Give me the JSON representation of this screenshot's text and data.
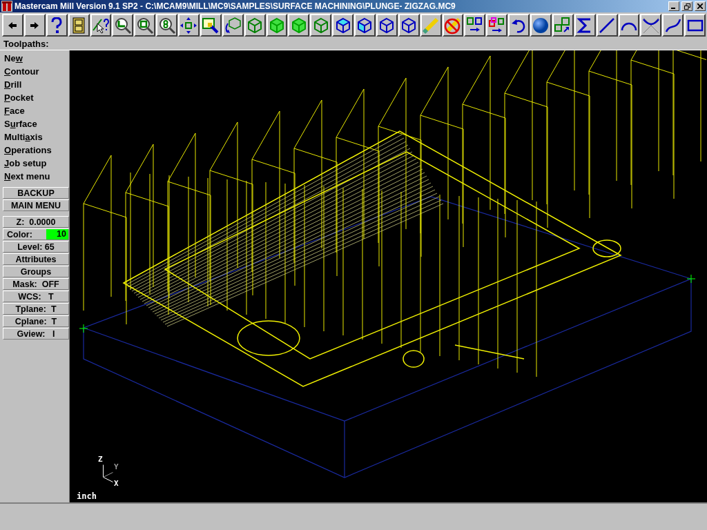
{
  "window": {
    "title": "Mastercam Mill Version 9.1 SP2 - C:\\MCAM9\\MILL\\MC9\\SAMPLES\\SURFACE MACHINING\\PLUNGE- ZIGZAG.MC9"
  },
  "toolbar": [
    {
      "kind": "arrow-left"
    },
    {
      "kind": "arrow-right"
    },
    {
      "kind": "help"
    },
    {
      "kind": "cabinet"
    },
    {
      "kind": "pointer-help"
    },
    {
      "kind": "zoom-window"
    },
    {
      "kind": "zoom-box"
    },
    {
      "kind": "zoom-eight"
    },
    {
      "kind": "pan"
    },
    {
      "kind": "paint"
    },
    {
      "kind": "rotate"
    },
    {
      "kind": "cube-green"
    },
    {
      "kind": "cube-green-light"
    },
    {
      "kind": "cube-green-light"
    },
    {
      "kind": "cube-green"
    },
    {
      "kind": "cube-blue-top"
    },
    {
      "kind": "cube-blue-front"
    },
    {
      "kind": "cube-blue"
    },
    {
      "kind": "cube-blue"
    },
    {
      "kind": "pencil"
    },
    {
      "kind": "pencil-no"
    },
    {
      "kind": "squares-arrow"
    },
    {
      "kind": "squares-arrow-color"
    },
    {
      "kind": "undo"
    },
    {
      "kind": "sphere"
    },
    {
      "kind": "cubes-arrow"
    },
    {
      "kind": "sigma"
    },
    {
      "kind": "line"
    },
    {
      "kind": "arc"
    },
    {
      "kind": "fillet"
    },
    {
      "kind": "spline"
    },
    {
      "kind": "rectangle"
    }
  ],
  "prompt": "Toolpaths:",
  "menu": [
    {
      "lead": "Ne",
      "key": "w"
    },
    {
      "key": "C",
      "rest": "ontour"
    },
    {
      "key": "D",
      "rest": "rill"
    },
    {
      "key": "P",
      "rest": "ocket"
    },
    {
      "key": "F",
      "rest": "ace"
    },
    {
      "lead": "S",
      "key": "u",
      "rest": "rface"
    },
    {
      "lead": "Multi",
      "key": "a",
      "rest": "xis"
    },
    {
      "key": "O",
      "rest": "perations"
    },
    {
      "key": "J",
      "rest": "ob setup"
    },
    {
      "key": "N",
      "rest": "ext menu"
    }
  ],
  "nav_buttons": [
    "BACKUP",
    "MAIN MENU"
  ],
  "status_buttons": [
    {
      "kind": "text",
      "label": "Z:  0.0000"
    },
    {
      "kind": "color",
      "label": "Color:",
      "value": "10"
    },
    {
      "kind": "text",
      "label": "Level: 65"
    },
    {
      "kind": "text",
      "label": "Attributes"
    },
    {
      "kind": "text",
      "label": "Groups"
    },
    {
      "kind": "text",
      "label": "Mask:  OFF"
    },
    {
      "kind": "text",
      "label": "WCS:   T"
    },
    {
      "kind": "text",
      "label": "Tplane:  T"
    },
    {
      "kind": "text",
      "label": "Cplane:  T"
    },
    {
      "kind": "text",
      "label": "Gview:   I"
    }
  ],
  "viewport": {
    "axes": {
      "z": "Z",
      "y": "Y",
      "x": "X"
    },
    "units": "inch"
  }
}
